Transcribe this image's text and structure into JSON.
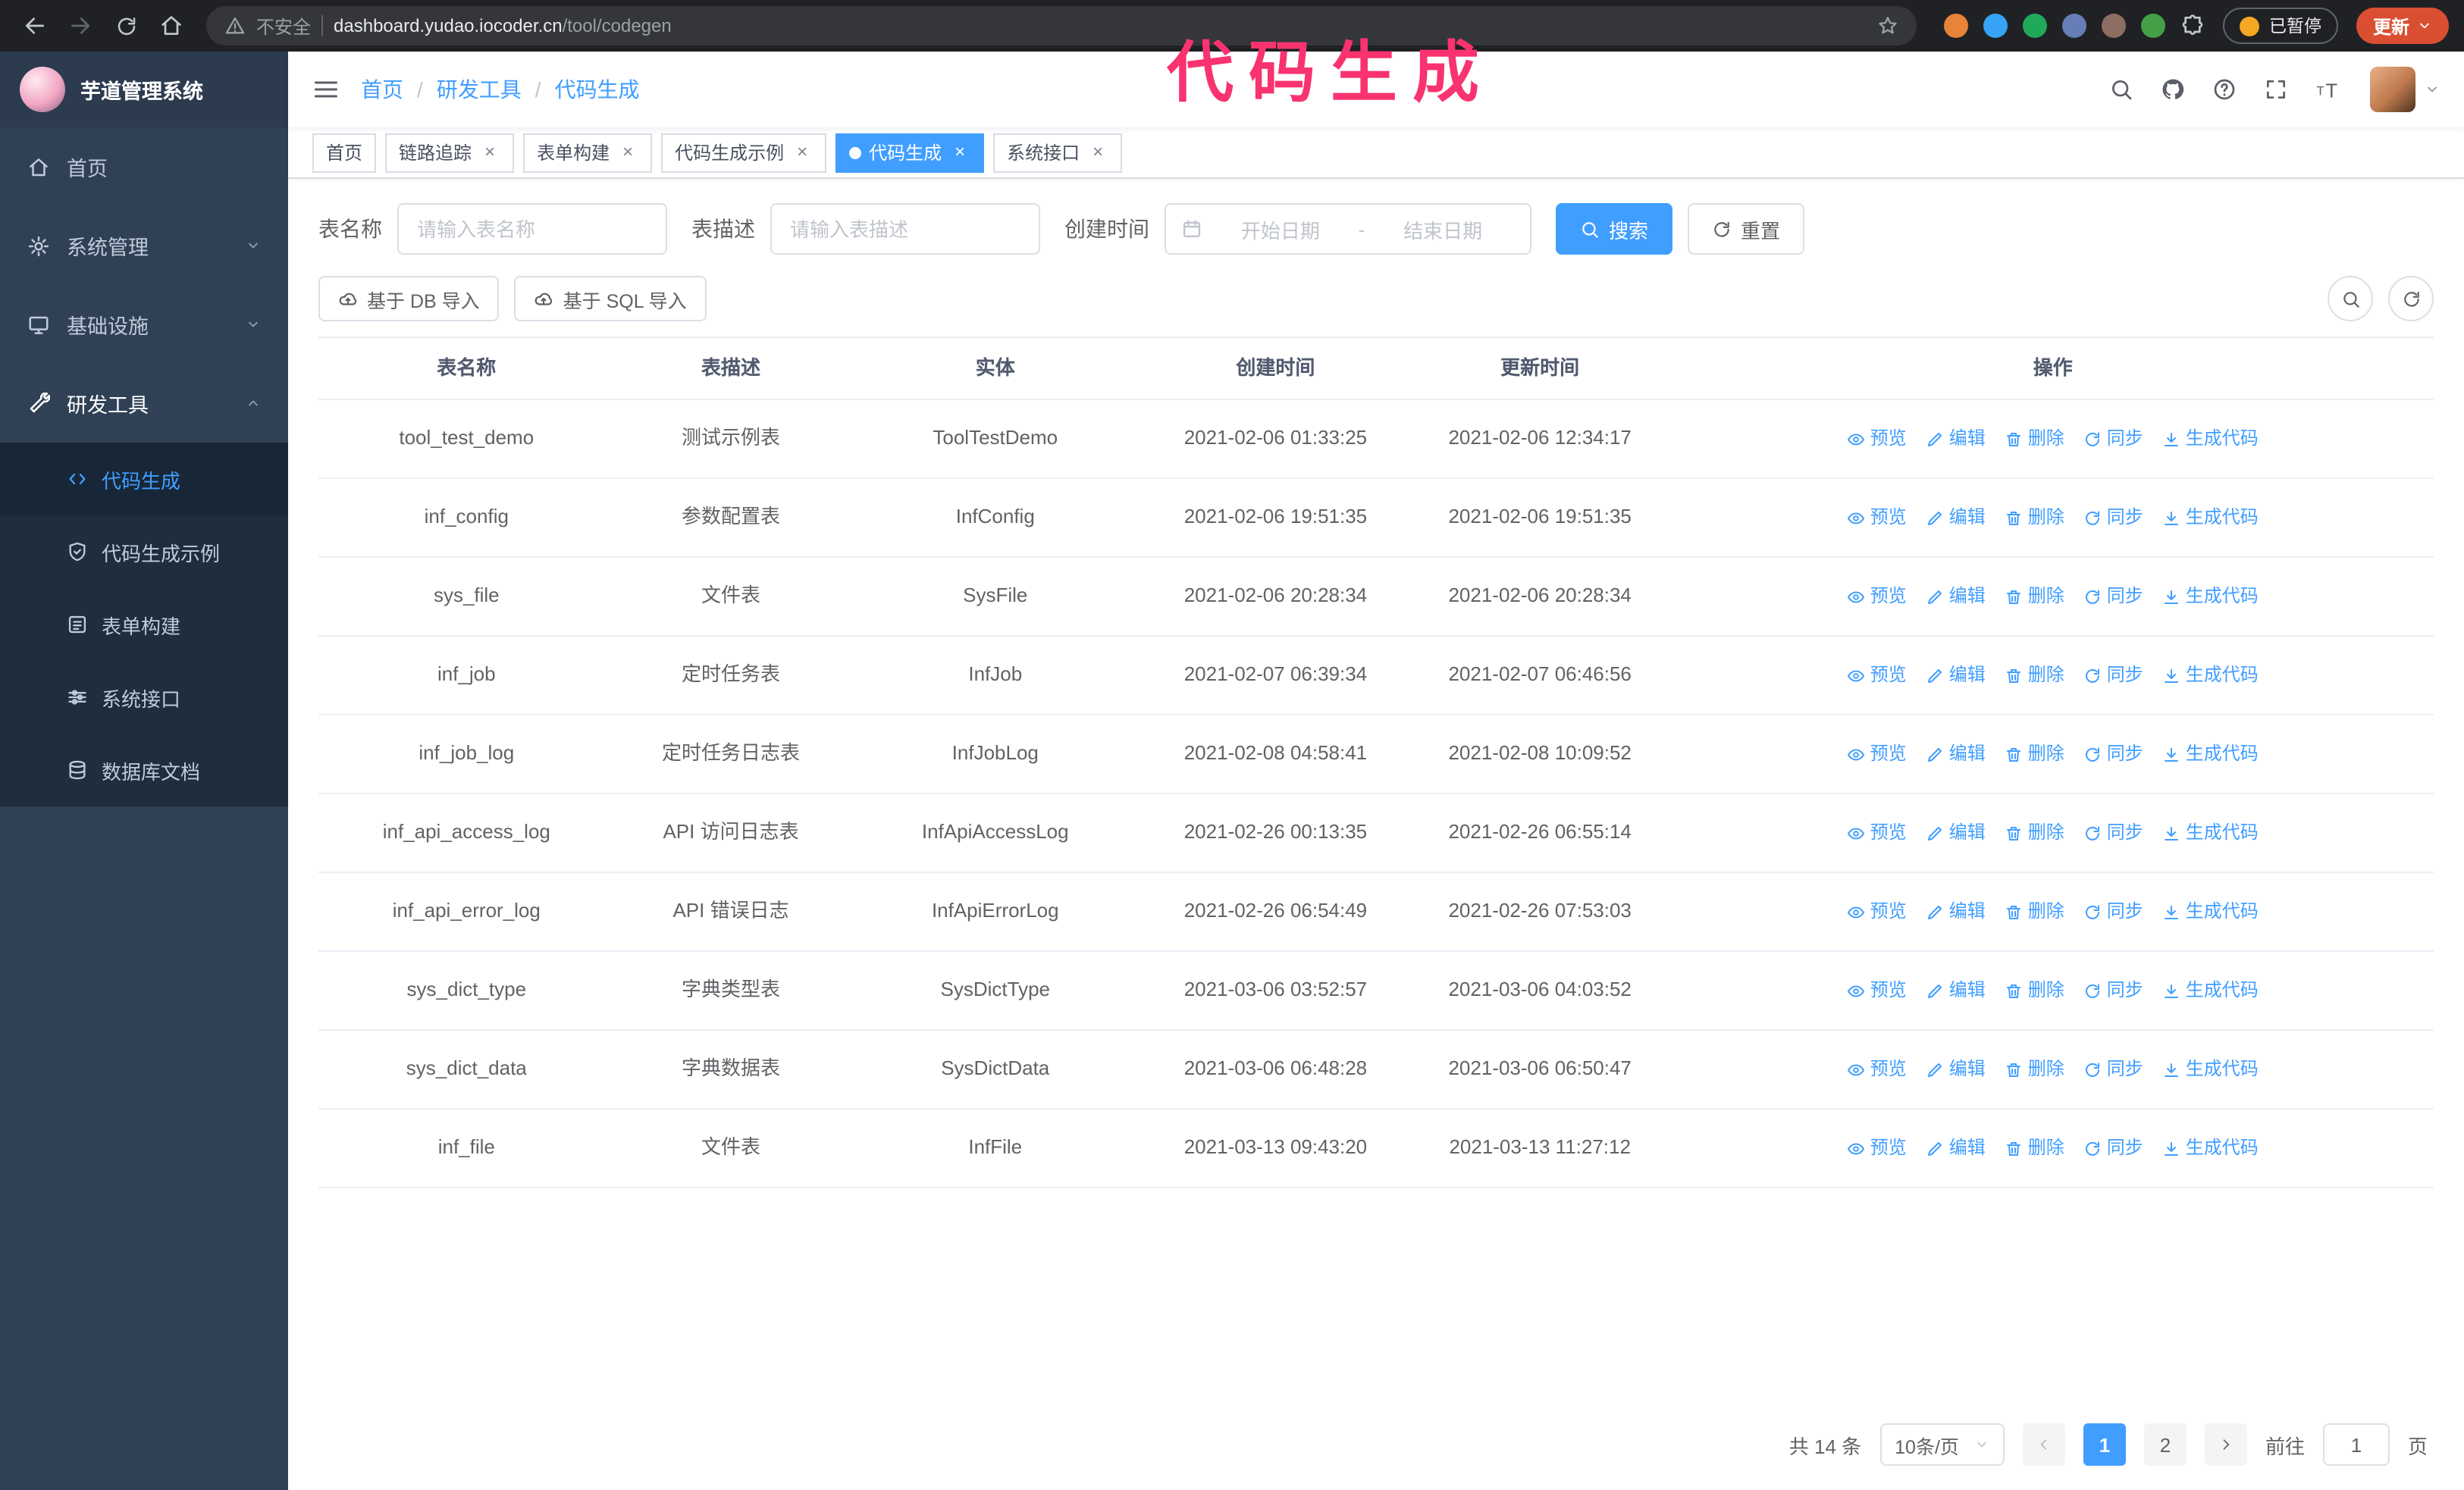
{
  "colors": {
    "accent": "#409eff",
    "sidebar_bg": "#304156",
    "submenu_bg": "#1f2d3d",
    "chrome_bg": "#202124",
    "update_button_bg": "#da4f32",
    "annotation_color": "#f8336f"
  },
  "annotation": {
    "text": "代码生成"
  },
  "browser": {
    "security_label": "不安全",
    "url_host": "dashboard.yudao.iocoder.cn",
    "url_path": "/tool/codegen",
    "paused_badge": "已暂停",
    "update_label": "更新"
  },
  "icons": {
    "close": "×"
  },
  "sidebar": {
    "logo_title": "芋道管理系统",
    "items": [
      {
        "label": "首页",
        "icon": "home-icon"
      },
      {
        "label": "系统管理",
        "icon": "gear-icon"
      },
      {
        "label": "基础设施",
        "icon": "monitor-icon"
      },
      {
        "label": "研发工具",
        "icon": "wrench-icon"
      }
    ],
    "subitems": [
      {
        "label": "代码生成",
        "icon": "code-icon",
        "active": true
      },
      {
        "label": "代码生成示例",
        "icon": "shield-icon",
        "active": false
      },
      {
        "label": "表单构建",
        "icon": "form-icon",
        "active": false
      },
      {
        "label": "系统接口",
        "icon": "sliders-icon",
        "active": false
      },
      {
        "label": "数据库文档",
        "icon": "database-icon",
        "active": false
      }
    ]
  },
  "navbar": {
    "breadcrumb": [
      "首页",
      "研发工具",
      "代码生成"
    ],
    "separator": "/"
  },
  "tabs": [
    {
      "label": "首页",
      "closable": false,
      "active": false
    },
    {
      "label": "链路追踪",
      "closable": true,
      "active": false
    },
    {
      "label": "表单构建",
      "closable": true,
      "active": false
    },
    {
      "label": "代码生成示例",
      "closable": true,
      "active": false
    },
    {
      "label": "代码生成",
      "closable": true,
      "active": true
    },
    {
      "label": "系统接口",
      "closable": true,
      "active": false
    }
  ],
  "filters": {
    "name_label": "表名称",
    "name_placeholder": "请输入表名称",
    "desc_label": "表描述",
    "desc_placeholder": "请输入表描述",
    "time_label": "创建时间",
    "start_placeholder": "开始日期",
    "separator": "-",
    "end_placeholder": "结束日期",
    "search": "搜索",
    "reset": "重置"
  },
  "toolbar": {
    "import_db": "基于 DB 导入",
    "import_sql": "基于 SQL 导入"
  },
  "table": {
    "columns": [
      "表名称",
      "表描述",
      "实体",
      "创建时间",
      "更新时间",
      "操作"
    ],
    "actions": [
      "预览",
      "编辑",
      "删除",
      "同步",
      "生成代码"
    ],
    "rows": [
      {
        "name": "tool_test_demo",
        "desc": "测试示例表",
        "entity": "ToolTestDemo",
        "created": "2021-02-06 01:33:25",
        "updated": "2021-02-06 12:34:17"
      },
      {
        "name": "inf_config",
        "desc": "参数配置表",
        "entity": "InfConfig",
        "created": "2021-02-06 19:51:35",
        "updated": "2021-02-06 19:51:35"
      },
      {
        "name": "sys_file",
        "desc": "文件表",
        "entity": "SysFile",
        "created": "2021-02-06 20:28:34",
        "updated": "2021-02-06 20:28:34"
      },
      {
        "name": "inf_job",
        "desc": "定时任务表",
        "entity": "InfJob",
        "created": "2021-02-07 06:39:34",
        "updated": "2021-02-07 06:46:56"
      },
      {
        "name": "inf_job_log",
        "desc": "定时任务日志表",
        "entity": "InfJobLog",
        "created": "2021-02-08 04:58:41",
        "updated": "2021-02-08 10:09:52"
      },
      {
        "name": "inf_api_access_log",
        "desc": "API 访问日志表",
        "entity": "InfApiAccessLog",
        "created": "2021-02-26 00:13:35",
        "updated": "2021-02-26 06:55:14"
      },
      {
        "name": "inf_api_error_log",
        "desc": "API 错误日志",
        "entity": "InfApiErrorLog",
        "created": "2021-02-26 06:54:49",
        "updated": "2021-02-26 07:53:03"
      },
      {
        "name": "sys_dict_type",
        "desc": "字典类型表",
        "entity": "SysDictType",
        "created": "2021-03-06 03:52:57",
        "updated": "2021-03-06 04:03:52"
      },
      {
        "name": "sys_dict_data",
        "desc": "字典数据表",
        "entity": "SysDictData",
        "created": "2021-03-06 06:48:28",
        "updated": "2021-03-06 06:50:47"
      },
      {
        "name": "inf_file",
        "desc": "文件表",
        "entity": "InfFile",
        "created": "2021-03-13 09:43:20",
        "updated": "2021-03-13 11:27:12"
      }
    ]
  },
  "pagination": {
    "total": "共 14 条",
    "page_size": "10条/页",
    "pages": [
      "1",
      "2"
    ],
    "current_page": "1",
    "goto_label": "前往",
    "goto_value": "1",
    "unit": "页"
  }
}
